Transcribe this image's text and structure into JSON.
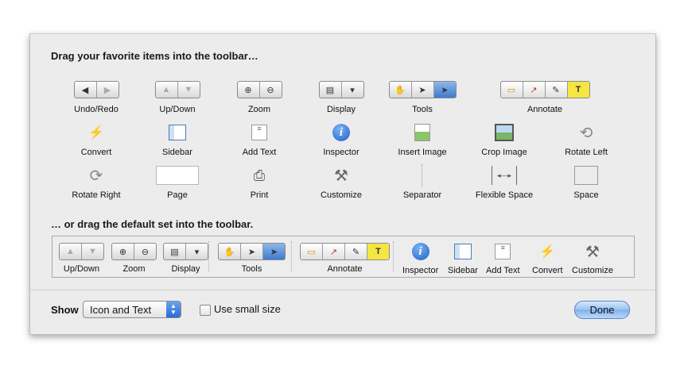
{
  "sheet": {
    "heading_items": "Drag your favorite items into the toolbar…",
    "heading_default": "… or drag the default set into the toolbar."
  },
  "palette": [
    {
      "label": "Undo/Redo",
      "icon": "undo-redo-control"
    },
    {
      "label": "Up/Down",
      "icon": "up-down-control"
    },
    {
      "label": "Zoom",
      "icon": "zoom-control"
    },
    {
      "label": "Display",
      "icon": "display-popup"
    },
    {
      "label": "Tools",
      "icon": "tools-control"
    },
    {
      "label": "Annotate",
      "icon": "annotate-control"
    },
    {
      "label": "Convert",
      "icon": "convert-icon"
    },
    {
      "label": "Sidebar",
      "icon": "sidebar-icon"
    },
    {
      "label": "Add Text",
      "icon": "add-text-icon"
    },
    {
      "label": "Inspector",
      "icon": "inspector-icon"
    },
    {
      "label": "Insert Image",
      "icon": "insert-image-icon"
    },
    {
      "label": "Crop Image",
      "icon": "crop-image-icon"
    },
    {
      "label": "Rotate Left",
      "icon": "rotate-left-icon"
    },
    {
      "label": "Rotate Right",
      "icon": "rotate-right-icon"
    },
    {
      "label": "Page",
      "icon": "page-icon"
    },
    {
      "label": "Print",
      "icon": "print-icon"
    },
    {
      "label": "Customize",
      "icon": "customize-icon"
    },
    {
      "label": "Separator",
      "icon": "separator-icon"
    },
    {
      "label": "Flexible Space",
      "icon": "flexible-space-icon"
    },
    {
      "label": "Space",
      "icon": "space-icon"
    }
  ],
  "default_set": [
    {
      "label": "Up/Down"
    },
    {
      "label": "Zoom"
    },
    {
      "label": "Display"
    },
    {
      "label": "Tools"
    },
    {
      "label": "Annotate"
    },
    {
      "label": "Inspector"
    },
    {
      "label": "Sidebar"
    },
    {
      "label": "Add Text"
    },
    {
      "label": "Convert"
    },
    {
      "label": "Customize"
    }
  ],
  "footer": {
    "show_label": "Show",
    "show_value": "Icon and Text",
    "small_size_label": "Use small size",
    "small_size_checked": false,
    "done_label": "Done"
  },
  "colors": {
    "accent": "#3d7bd0",
    "sheet_bg": "#ececec",
    "done_button": "#97c1f0"
  }
}
